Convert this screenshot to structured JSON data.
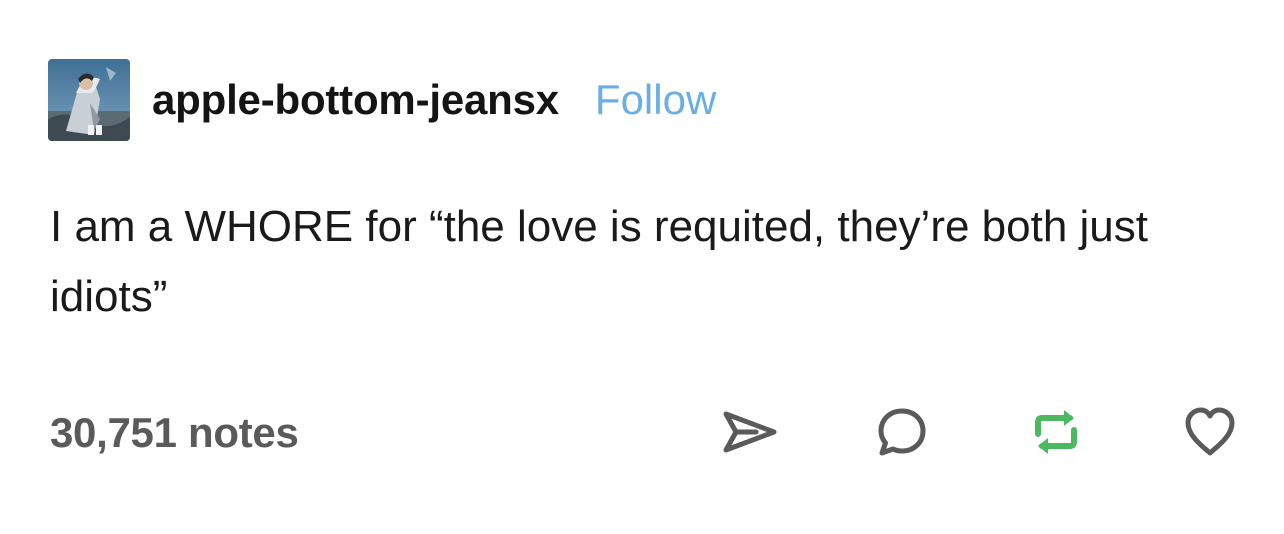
{
  "post": {
    "blog_name": "apple-bottom-jeansx",
    "follow_label": "Follow",
    "body_text": "I am a WHORE for “the love is requited, they’re both just idiots”",
    "notes_count": "30,751 notes"
  },
  "icons": {
    "share": "share-icon",
    "reply": "reply-icon",
    "reblog": "reblog-icon",
    "like": "heart-icon"
  },
  "colors": {
    "follow_link": "#6aaee6",
    "reblog_green": "#4cb860",
    "icon_gray": "#5a5a5a",
    "text": "#1a1a1a"
  }
}
